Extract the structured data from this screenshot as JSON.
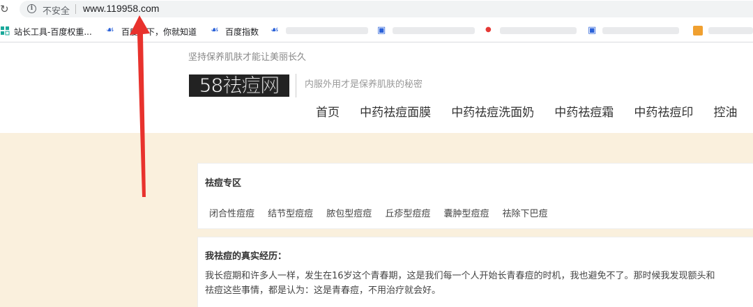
{
  "browser": {
    "security_label": "不安全",
    "url": "www.119958.com"
  },
  "bookmarks": [
    {
      "label": "站长工具-百度权重..."
    },
    {
      "label": "百度一下，你就知道"
    },
    {
      "label": "百度指数"
    }
  ],
  "header": {
    "slogan": "坚持保养肌肤才能让美丽长久",
    "logo_text": "58祛痘网",
    "tagline": "内服外用才是保养肌肤的秘密",
    "nav": [
      "首页",
      "中药祛痘面膜",
      "中药祛痘洗面奶",
      "中药祛痘霜",
      "中药祛痘印",
      "控油"
    ]
  },
  "section1": {
    "title": "祛痘专区",
    "tags": [
      "闭合性痘痘",
      "结节型痘痘",
      "脓包型痘痘",
      "丘疹型痘痘",
      "囊肿型痘痘",
      "祛除下巴痘"
    ]
  },
  "section2": {
    "title": "我祛痘的真实经历：",
    "paragraph": "我长痘期和许多人一样，发生在16岁这个青春期，这是我们每一个人开始长青春痘的时机，我也避免不了。那时候我发现额头和",
    "paragraph_cont": "祛痘这些事情，都是认为：这是青春痘，不用治疗就会好。"
  },
  "colors": {
    "main_bg": "#faf0dd",
    "arrow": "#e8322d",
    "logo_bg": "#222222"
  }
}
